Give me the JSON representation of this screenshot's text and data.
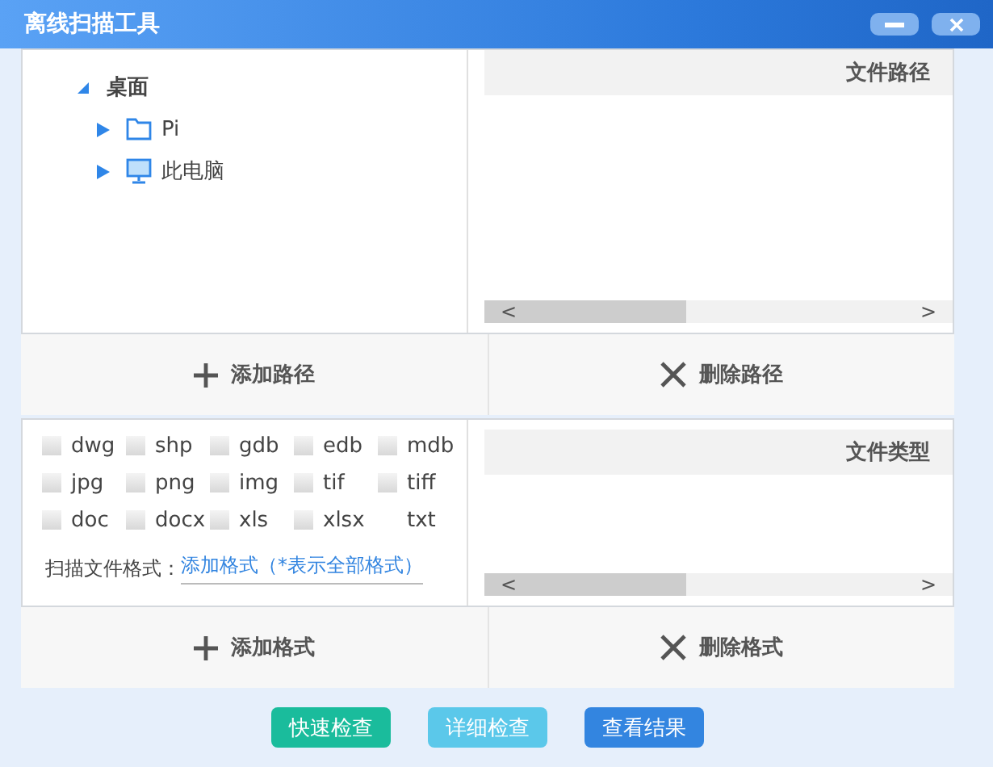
{
  "window": {
    "title": "离线扫描工具",
    "controls": [
      {
        "kind": "minimize"
      },
      {
        "kind": "close"
      }
    ]
  },
  "path_section": {
    "tree": {
      "label": "桌面",
      "expanded": true,
      "children": [
        {
          "label": "Pi",
          "kind": "folder",
          "expanded": false
        },
        {
          "label": "此电脑",
          "kind": "computer",
          "expanded": false
        }
      ]
    },
    "table": {
      "column": "文件路径",
      "scroll_left": "<",
      "scroll_right": ">"
    },
    "buttons": [
      {
        "kind": "add",
        "label": "添加路径"
      },
      {
        "kind": "delete",
        "label": "删除路径"
      }
    ]
  },
  "format_section": {
    "formats": [
      {
        "label": "dwg",
        "kind": "checkbox",
        "checked": false
      },
      {
        "label": "shp",
        "kind": "checkbox",
        "checked": false
      },
      {
        "label": "gdb",
        "kind": "checkbox",
        "checked": false
      },
      {
        "label": "edb",
        "kind": "checkbox",
        "checked": false
      },
      {
        "label": "mdb",
        "kind": "checkbox",
        "checked": false
      },
      {
        "label": "jpg",
        "kind": "checkbox",
        "checked": false
      },
      {
        "label": "png",
        "kind": "checkbox",
        "checked": false
      },
      {
        "label": "img",
        "kind": "checkbox",
        "checked": false
      },
      {
        "label": "tif",
        "kind": "checkbox",
        "checked": false
      },
      {
        "label": "tiff",
        "kind": "checkbox",
        "checked": false
      },
      {
        "label": "doc",
        "kind": "checkbox",
        "checked": false
      },
      {
        "label": "docx",
        "kind": "checkbox",
        "checked": false
      },
      {
        "label": "xls",
        "kind": "checkbox",
        "checked": false
      },
      {
        "label": "xlsx",
        "kind": "checkbox",
        "checked": false
      },
      {
        "label": "txt",
        "kind": "plain"
      }
    ],
    "scan_label": "扫描文件格式：",
    "add_link": "添加格式（*表示全部格式）",
    "table": {
      "column": "文件类型",
      "scroll_left": "<",
      "scroll_right": ">"
    },
    "buttons": [
      {
        "kind": "add",
        "label": "添加格式"
      },
      {
        "kind": "delete",
        "label": "删除格式"
      }
    ]
  },
  "actions": [
    {
      "label": "快速检查",
      "color": "#1abc9c"
    },
    {
      "label": "详细检查",
      "color": "#5bc8ea"
    },
    {
      "label": "查看结果",
      "color": "#3385e0"
    }
  ]
}
